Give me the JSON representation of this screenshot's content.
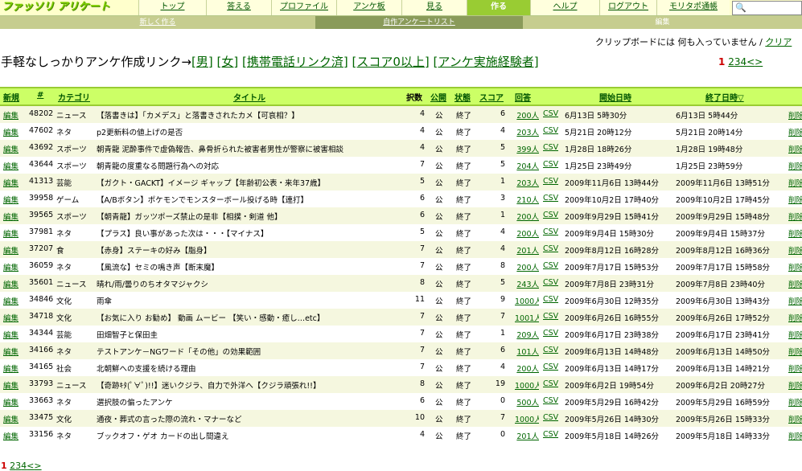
{
  "header": {
    "logo": "ファッソリ アリケート",
    "nav": [
      {
        "label": "トップ",
        "width": 83
      },
      {
        "label": "答える",
        "width": 80
      },
      {
        "label": "プロファイル",
        "width": 80
      },
      {
        "label": "アンケ板",
        "width": 80
      },
      {
        "label": "見る",
        "width": 80
      },
      {
        "label": "作る",
        "width": 78,
        "active": true
      },
      {
        "label": "ヘルプ",
        "width": 85
      },
      {
        "label": "ログアウト",
        "width": 70
      },
      {
        "label": "モリタポ通帳",
        "width": 90
      }
    ],
    "search_icon": "search-icon"
  },
  "subnav": {
    "items": [
      "新しく作る",
      "自作アンケートリスト",
      "編集"
    ]
  },
  "clipboard": {
    "text": "クリップボードには 何も入っていません / ",
    "clear": "クリア"
  },
  "headline": {
    "prefix": "手軽なしっかりアンケ作成リンク→",
    "links": [
      "[男]",
      "[女]",
      "[携帯電話リンク済]",
      "[スコア0以上]",
      "[アンケ実施経験者]"
    ]
  },
  "pager": {
    "current": "1",
    "pages": [
      "2",
      "3",
      "4"
    ],
    "prev": "<",
    "next": ">"
  },
  "table": {
    "headers": {
      "new": "新規",
      "id": "#",
      "category": "カテゴリ",
      "title": "タイトル",
      "options": "択数",
      "public": "公開",
      "status": "状態",
      "score": "スコア",
      "answers": "回答",
      "start": "開始日時",
      "end": "終了日時▽"
    },
    "rows": [
      {
        "edit": "編集",
        "id": "48202",
        "cat": "ニュース",
        "title": "【落書きは】「カメデス」と落書きされたカメ【可哀相？】",
        "opt": "4",
        "pub": "公",
        "stat": "終了",
        "score": "6",
        "ans": "200人",
        "csv": "CSV",
        "start": "6月13日 5時30分",
        "end": "6月13日 5時44分",
        "del": "削除"
      },
      {
        "edit": "編集",
        "id": "47602",
        "cat": "ネタ",
        "title": "p2更新料の値上げの是否",
        "opt": "4",
        "pub": "公",
        "stat": "終了",
        "score": "4",
        "ans": "203人",
        "csv": "CSV",
        "start": "5月21日 20時12分",
        "end": "5月21日 20時14分",
        "del": "削除"
      },
      {
        "edit": "編集",
        "id": "43692",
        "cat": "スポーツ",
        "title": "朝青龍 泥酔事件で虚偽報告、鼻骨折られた被害者男性が警察に被害相談",
        "opt": "4",
        "pub": "公",
        "stat": "終了",
        "score": "5",
        "ans": "399人",
        "csv": "CSV",
        "start": "1月28日 18時26分",
        "end": "1月28日 19時48分",
        "del": "削除"
      },
      {
        "edit": "編集",
        "id": "43644",
        "cat": "スポーツ",
        "title": "朝青龍の度重なる問題行為への対応",
        "opt": "7",
        "pub": "公",
        "stat": "終了",
        "score": "5",
        "ans": "204人",
        "csv": "CSV",
        "start": "1月25日 23時49分",
        "end": "1月25日 23時59分",
        "del": "削除"
      },
      {
        "edit": "編集",
        "id": "41313",
        "cat": "芸能",
        "title": "【ガクト・GACKT】イメージ ギャップ【年齢初公表・来年37歳】",
        "opt": "5",
        "pub": "公",
        "stat": "終了",
        "score": "1",
        "ans": "203人",
        "csv": "CSV",
        "start": "2009年11月6日 13時44分",
        "end": "2009年11月6日 13時51分",
        "del": "削除"
      },
      {
        "edit": "編集",
        "id": "39958",
        "cat": "ゲーム",
        "title": "【A/Bボタン】ポケモンでモンスターボール投げる時【連打】",
        "opt": "6",
        "pub": "公",
        "stat": "終了",
        "score": "3",
        "ans": "210人",
        "csv": "CSV",
        "start": "2009年10月2日 17時40分",
        "end": "2009年10月2日 17時45分",
        "del": "削除"
      },
      {
        "edit": "編集",
        "id": "39565",
        "cat": "スポーツ",
        "title": "【朝青龍】ガッツポーズ禁止の是非【相撲・剣道 他】",
        "opt": "6",
        "pub": "公",
        "stat": "終了",
        "score": "1",
        "ans": "200人",
        "csv": "CSV",
        "start": "2009年9月29日 15時41分",
        "end": "2009年9月29日 15時48分",
        "del": "削除"
      },
      {
        "edit": "編集",
        "id": "37981",
        "cat": "ネタ",
        "title": "【プラス】良い事があった次は・・・【マイナス】",
        "opt": "5",
        "pub": "公",
        "stat": "終了",
        "score": "4",
        "ans": "200人",
        "csv": "CSV",
        "start": "2009年9月4日 15時30分",
        "end": "2009年9月4日 15時37分",
        "del": "削除"
      },
      {
        "edit": "編集",
        "id": "37207",
        "cat": "食",
        "title": "【赤身】ステーキの好み【脂身】",
        "opt": "7",
        "pub": "公",
        "stat": "終了",
        "score": "4",
        "ans": "201人",
        "csv": "CSV",
        "start": "2009年8月12日 16時28分",
        "end": "2009年8月12日 16時36分",
        "del": "削除"
      },
      {
        "edit": "編集",
        "id": "36059",
        "cat": "ネタ",
        "title": "【風流な】セミの鳴き声【断末魔】",
        "opt": "7",
        "pub": "公",
        "stat": "終了",
        "score": "8",
        "ans": "200人",
        "csv": "CSV",
        "start": "2009年7月17日 15時53分",
        "end": "2009年7月17日 15時58分",
        "del": "削除"
      },
      {
        "edit": "編集",
        "id": "35601",
        "cat": "ニュース",
        "title": "晴れ/雨/曇りのちオタマジャクシ",
        "opt": "8",
        "pub": "公",
        "stat": "終了",
        "score": "5",
        "ans": "243人",
        "csv": "CSV",
        "start": "2009年7月8日 23時31分",
        "end": "2009年7月8日 23時40分",
        "del": "削除"
      },
      {
        "edit": "編集",
        "id": "34846",
        "cat": "文化",
        "title": "雨傘",
        "opt": "11",
        "pub": "公",
        "stat": "終了",
        "score": "9",
        "ans": "1000人",
        "csv": "CSV",
        "start": "2009年6月30日 12時35分",
        "end": "2009年6月30日 13時43分",
        "del": "削除"
      },
      {
        "edit": "編集",
        "id": "34718",
        "cat": "文化",
        "title": "【お気に入り お勧め】 動画 ムービー 【笑い・感動・癒し…etc】",
        "opt": "7",
        "pub": "公",
        "stat": "終了",
        "score": "7",
        "ans": "1001人",
        "csv": "CSV",
        "start": "2009年6月26日 16時55分",
        "end": "2009年6月26日 17時52分",
        "del": "削除"
      },
      {
        "edit": "編集",
        "id": "34344",
        "cat": "芸能",
        "title": "田畑智子と保田圭",
        "opt": "7",
        "pub": "公",
        "stat": "終了",
        "score": "1",
        "ans": "209人",
        "csv": "CSV",
        "start": "2009年6月17日 23時38分",
        "end": "2009年6月17日 23時41分",
        "del": "削除"
      },
      {
        "edit": "編集",
        "id": "34166",
        "cat": "ネタ",
        "title": "テストアンケ－NGワード「その他」の効果範囲",
        "opt": "7",
        "pub": "公",
        "stat": "終了",
        "score": "6",
        "ans": "101人",
        "csv": "CSV",
        "start": "2009年6月13日 14時48分",
        "end": "2009年6月13日 14時50分",
        "del": "削除"
      },
      {
        "edit": "編集",
        "id": "34165",
        "cat": "社会",
        "title": "北朝鮮への支援を続ける理由",
        "opt": "7",
        "pub": "公",
        "stat": "終了",
        "score": "4",
        "ans": "200人",
        "csv": "CSV",
        "start": "2009年6月13日 14時17分",
        "end": "2009年6月13日 14時21分",
        "del": "削除"
      },
      {
        "edit": "編集",
        "id": "33793",
        "cat": "ニュース",
        "title": "【奇跡ｷﾀ(ﾟ∀ﾟ)!!】迷いクジラ、自力で外洋へ【クジラ頑張れ!!】",
        "opt": "8",
        "pub": "公",
        "stat": "終了",
        "score": "19",
        "ans": "1000人",
        "csv": "CSV",
        "start": "2009年6月2日 19時54分",
        "end": "2009年6月2日 20時27分",
        "del": "削除"
      },
      {
        "edit": "編集",
        "id": "33663",
        "cat": "ネタ",
        "title": "選択肢の偏ったアンケ",
        "opt": "6",
        "pub": "公",
        "stat": "終了",
        "score": "0",
        "ans": "500人",
        "csv": "CSV",
        "start": "2009年5月29日 16時42分",
        "end": "2009年5月29日 16時59分",
        "del": "削除"
      },
      {
        "edit": "編集",
        "id": "33475",
        "cat": "文化",
        "title": "通夜・葬式の言った際の流れ・マナーなど",
        "opt": "10",
        "pub": "公",
        "stat": "終了",
        "score": "7",
        "ans": "1000人",
        "csv": "CSV",
        "start": "2009年5月26日 14時30分",
        "end": "2009年5月26日 15時33分",
        "del": "削除"
      },
      {
        "edit": "編集",
        "id": "33156",
        "cat": "ネタ",
        "title": "ブックオフ・ゲオ カードの出し間違え",
        "opt": "4",
        "pub": "公",
        "stat": "終了",
        "score": "0",
        "ans": "201人",
        "csv": "CSV",
        "start": "2009年5月18日 14時26分",
        "end": "2009年5月18日 14時33分",
        "del": "削除"
      }
    ]
  }
}
